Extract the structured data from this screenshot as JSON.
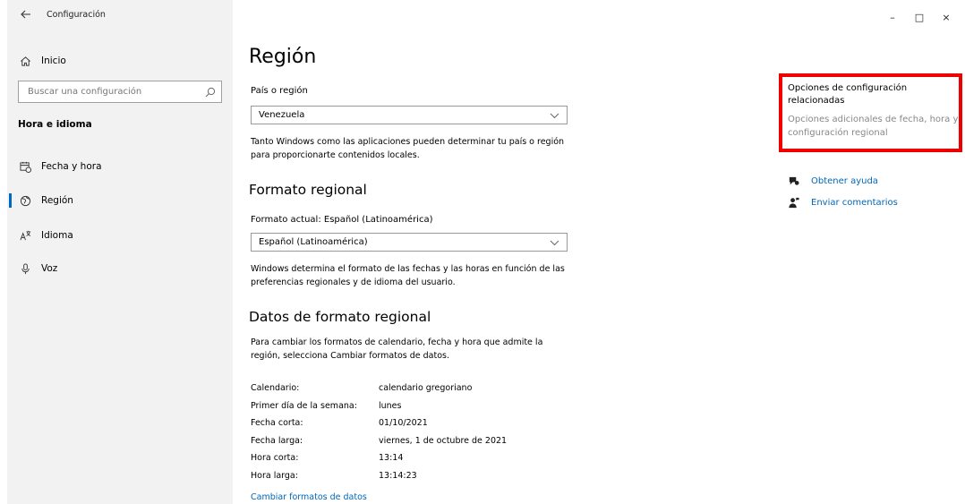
{
  "window": {
    "title": "Configuración",
    "back_icon": "arrow-left-icon",
    "controls": {
      "minimize": "–",
      "maximize": "□",
      "close": "×"
    }
  },
  "sidebar": {
    "home_label": "Inicio",
    "search_placeholder": "Buscar una configuración",
    "section_title": "Hora e idioma",
    "items": [
      {
        "label": "Fecha y hora",
        "icon": "calendar-clock-icon",
        "active": false
      },
      {
        "label": "Región",
        "icon": "globe-icon",
        "active": true
      },
      {
        "label": "Idioma",
        "icon": "language-icon",
        "active": false
      },
      {
        "label": "Voz",
        "icon": "microphone-icon",
        "active": false
      }
    ]
  },
  "main": {
    "title": "Región",
    "country_label": "País o región",
    "country_value": "Venezuela",
    "country_desc": "Tanto Windows como las aplicaciones pueden determinar tu país o región para proporcionarte contenidos locales.",
    "format_heading": "Formato regional",
    "format_current_label": "Formato actual: Español (Latinoamérica)",
    "format_value": "Español (Latinoamérica)",
    "format_desc": "Windows determina el formato de las fechas y las horas en función de las preferencias regionales y de idioma del usuario.",
    "data_heading": "Datos de formato regional",
    "data_desc": "Para cambiar los formatos de calendario, fecha y hora que admite la región, selecciona Cambiar formatos de datos.",
    "rows": [
      {
        "key": "Calendario:",
        "value": "calendario gregoriano"
      },
      {
        "key": "Primer día de la semana:",
        "value": "lunes"
      },
      {
        "key": "Fecha corta:",
        "value": "01/10/2021"
      },
      {
        "key": "Fecha larga:",
        "value": "viernes, 1 de octubre de 2021"
      },
      {
        "key": "Hora corta:",
        "value": "13:14"
      },
      {
        "key": "Hora larga:",
        "value": "13:14:23"
      }
    ],
    "change_link": "Cambiar formatos de datos"
  },
  "related": {
    "title": "Opciones de configuración relacionadas",
    "link": "Opciones adicionales de fecha, hora y configuración regional",
    "highlight_color": "#ee0000",
    "help_label": "Obtener ayuda",
    "feedback_label": "Enviar comentarios"
  },
  "colors": {
    "accent": "#0067c0",
    "link": "#0067b8",
    "sidebar_bg": "#f2f2f2"
  }
}
